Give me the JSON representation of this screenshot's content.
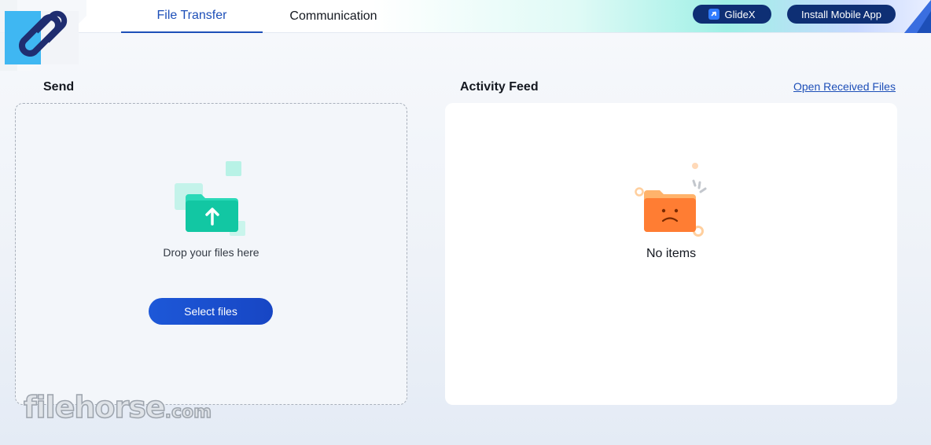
{
  "header": {
    "tabs": [
      {
        "label": "File Transfer",
        "active": true
      },
      {
        "label": "Communication",
        "active": false
      }
    ],
    "glidex_label": "GlideX",
    "install_label": "Install Mobile App"
  },
  "send": {
    "title": "Send",
    "drop_text": "Drop your files here",
    "select_label": "Select files"
  },
  "feed": {
    "title": "Activity Feed",
    "open_link": "Open Received Files",
    "empty_text": "No items"
  },
  "watermark": {
    "text": "filehorse",
    "suffix": ".com"
  },
  "colors": {
    "accent": "#1d4fb8",
    "button": "#1d58d8",
    "pill": "#0e2f74",
    "upload_folder": "#22d3b0",
    "empty_folder": "#ff7a2e"
  }
}
